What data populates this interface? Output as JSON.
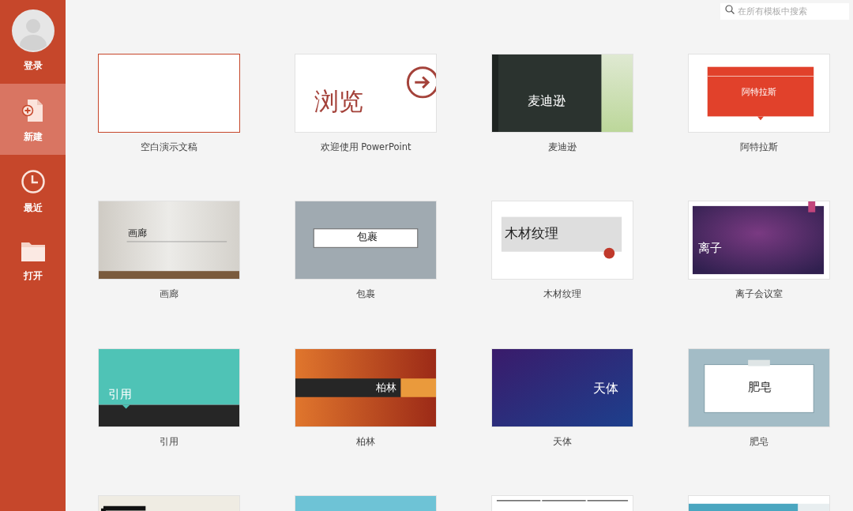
{
  "sidebar": {
    "account": {
      "label": "登录"
    },
    "items": [
      {
        "kind": "new",
        "label": "新建",
        "selected": true
      },
      {
        "kind": "recent",
        "label": "最近",
        "selected": false
      },
      {
        "kind": "open",
        "label": "打开",
        "selected": false
      }
    ]
  },
  "search": {
    "placeholder": "在所有模板中搜索"
  },
  "templates": [
    {
      "kind": "blank",
      "label": "空白演示文稿",
      "selected": true
    },
    {
      "kind": "browse",
      "slide_text": "浏览",
      "label": "欢迎使用 PowerPoint",
      "selected": false
    },
    {
      "kind": "madison",
      "slide_text": "麦迪逊",
      "label": "麦迪逊",
      "selected": false
    },
    {
      "kind": "atlas",
      "slide_text": "阿特拉斯",
      "label": "阿特拉斯",
      "selected": false
    },
    {
      "kind": "gallery",
      "slide_text": "画廊",
      "label": "画廊",
      "selected": false
    },
    {
      "kind": "parcel",
      "slide_text": "包裹",
      "label": "包裹",
      "selected": false
    },
    {
      "kind": "wood",
      "slide_text": "木材纹理",
      "label": "木材纹理",
      "selected": false
    },
    {
      "kind": "ion",
      "slide_text": "离子",
      "label": "离子会议室",
      "selected": false
    },
    {
      "kind": "quote",
      "slide_text": "引用",
      "label": "引用",
      "selected": false
    },
    {
      "kind": "berlin",
      "slide_text": "柏林",
      "label": "柏林",
      "selected": false
    },
    {
      "kind": "celestial",
      "slide_text": "天体",
      "label": "天体",
      "selected": false
    },
    {
      "kind": "soap",
      "slide_text": "肥皂",
      "label": "肥皂",
      "selected": false
    },
    {
      "kind": "frame",
      "selected": false
    },
    {
      "kind": "aqua",
      "selected": false
    },
    {
      "kind": "lines",
      "selected": false
    },
    {
      "kind": "teal",
      "selected": false
    }
  ]
}
